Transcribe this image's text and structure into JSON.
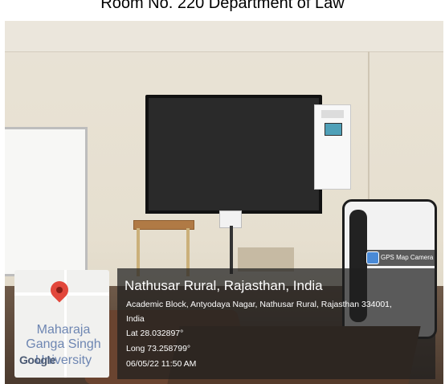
{
  "caption": "Room No. 220 Department of Law",
  "gps_badge": {
    "label": "GPS Map Camera",
    "icon": "camera-icon"
  },
  "location": {
    "title": "Nathusar Rural, Rajasthan, India",
    "address": "Academic Block, Antyodaya Nagar, Nathusar Rural, Rajasthan 334001,",
    "country": "India",
    "lat": "Lat 28.032897°",
    "long": "Long 73.258799°",
    "datetime": "06/05/22 11:50 AM"
  },
  "map": {
    "label_line1": "Maharaja",
    "label_line2": "Ganga Singh",
    "label_line3": "University",
    "google": "Google",
    "pin_icon": "map-pin-icon",
    "pin_color": "#e2473b"
  }
}
